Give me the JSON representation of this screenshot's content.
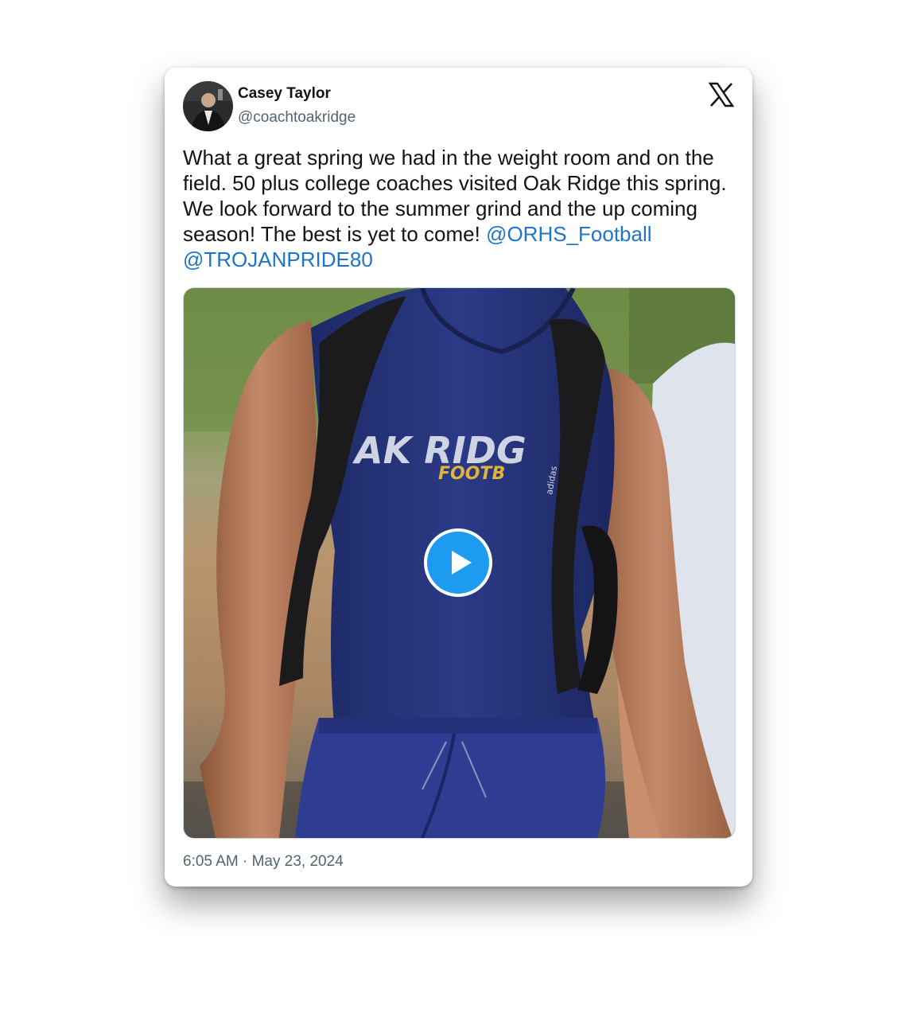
{
  "author": {
    "name": "Casey Taylor",
    "handle": "@coachtoakridge"
  },
  "platform_icon": "x-logo-icon",
  "tweet": {
    "text_parts": [
      "What a great spring we had in the weight room and on the field. 50 plus college coaches visited Oak Ridge this spring. We look forward to the summer grind and the up coming season! The best is yet to come! ",
      "@ORHS_Football",
      " ",
      "@TROJANPRIDE80"
    ],
    "media": {
      "type": "video",
      "play_icon": "play-icon",
      "shirt_text_main": "AK RIDG",
      "shirt_text_sub": "FOOTB",
      "strap_text": "adidas"
    },
    "timestamp": "6:05 AM · May 23, 2024"
  },
  "colors": {
    "link": "#1d74c9",
    "play_button": "#1d9bf0",
    "muted_text": "#536471",
    "text": "#0f1419"
  }
}
